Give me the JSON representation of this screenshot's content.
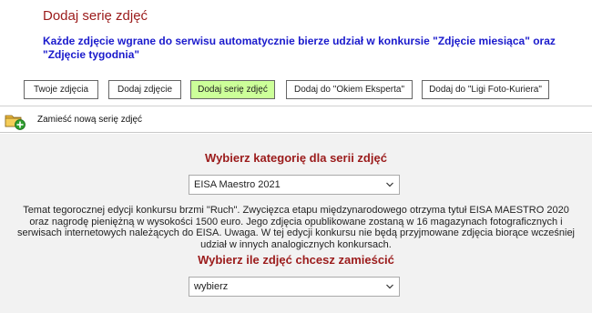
{
  "header": {
    "title": "Dodaj serię zdjęć",
    "subtitle": "Każde zdjęcie wgrane do serwisu automatycznie bierze udział w konkursie \"Zdjęcie miesiąca\" oraz \"Zdjęcie tygodnia\""
  },
  "tabs": [
    {
      "label": "Twoje zdjęcia",
      "active": false
    },
    {
      "label": "Dodaj zdjęcie",
      "active": false
    },
    {
      "label": "Dodaj serię zdjęć",
      "active": true
    },
    {
      "label": "Dodaj do \"Okiem Eksperta\"",
      "active": false
    },
    {
      "label": "Dodaj do \"Ligi Foto-Kuriera\"",
      "active": false
    }
  ],
  "section": {
    "label": "Zamieść nową serię zdjęć",
    "icon": "folder-add-icon"
  },
  "form": {
    "category_heading": "Wybierz kategorię dla serii zdjęć",
    "category_value": "EISA Maestro 2021",
    "description": "Temat tegorocznej edycji konkursu brzmi \"Ruch\". Zwycięzca etapu  międzynarodowego otrzyma tytuł EISA MAESTRO 2020 oraz nagrodę pieniężną w wysokości 1500 euro. Jego zdjęcia opublikowane zostaną w 16 magazynach fotograficznych i serwisach internetowych należących do EISA. Uwaga. W tej edycji konkursu nie będą przyjmowane zdjęcia biorące wcześniej udział w innych analogicznych konkursach.",
    "count_heading": "Wybierz ile zdjęć chcesz zamieścić",
    "count_value": "wybierz"
  },
  "colors": {
    "title_red": "#9b1b1b",
    "subtitle_blue": "#1a1acc",
    "active_tab": "#ccff99",
    "content_bg": "#f2f2f2"
  }
}
